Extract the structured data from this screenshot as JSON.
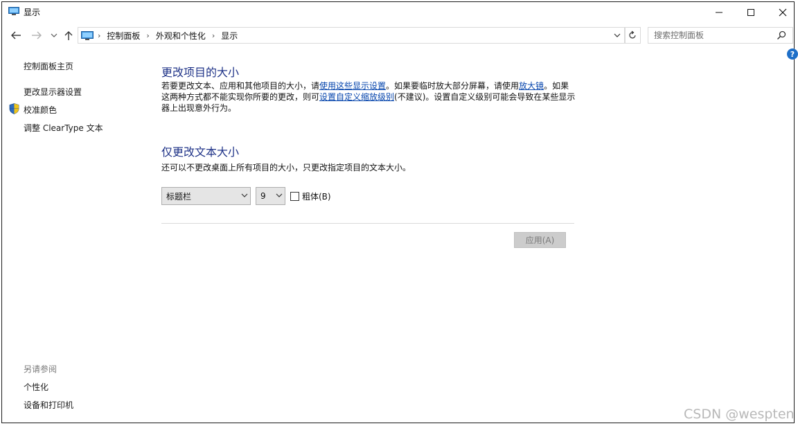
{
  "window": {
    "title": "显示",
    "minimize_icon": "minimize-icon",
    "maximize_icon": "maximize-icon",
    "close_icon": "close-icon"
  },
  "address": {
    "breadcrumbs": [
      "控制面板",
      "外观和个性化",
      "显示"
    ],
    "separator": "›",
    "search_placeholder": "搜索控制面板"
  },
  "sidebar": {
    "home": "控制面板主页",
    "links": [
      "更改显示器设置",
      "校准颜色",
      "调整 ClearType 文本"
    ],
    "see_also_title": "另请参阅",
    "see_also": [
      "个性化",
      "设备和打印机"
    ]
  },
  "main": {
    "heading1": "更改项目的大小",
    "para": {
      "t1": "若要更改文本、应用和其他项目的大小，请",
      "link1": "使用这些显示设置",
      "t2": "。如果要临时放大部分屏幕，请使用",
      "link2": "放大镜",
      "t3": "。如果这两种方式都不能实现你所要的更改，则可",
      "link3": "设置自定义缩放级别",
      "t4": "(不建议)。设置自定义级别可能会导致在某些显示器上出现意外行为。"
    },
    "heading2": "仅更改文本大小",
    "subtext": "还可以不更改桌面上所有项目的大小，只更改指定项目的文本大小。",
    "item_select": "标题栏",
    "size_select": "9",
    "bold_label": "粗体(B)",
    "bold_checked": false,
    "apply_label": "应用(A)"
  },
  "watermark": "CSDN @wespten",
  "colors": {
    "heading": "#1e3287",
    "link": "#0645ad",
    "help": "#1e6fc8"
  }
}
